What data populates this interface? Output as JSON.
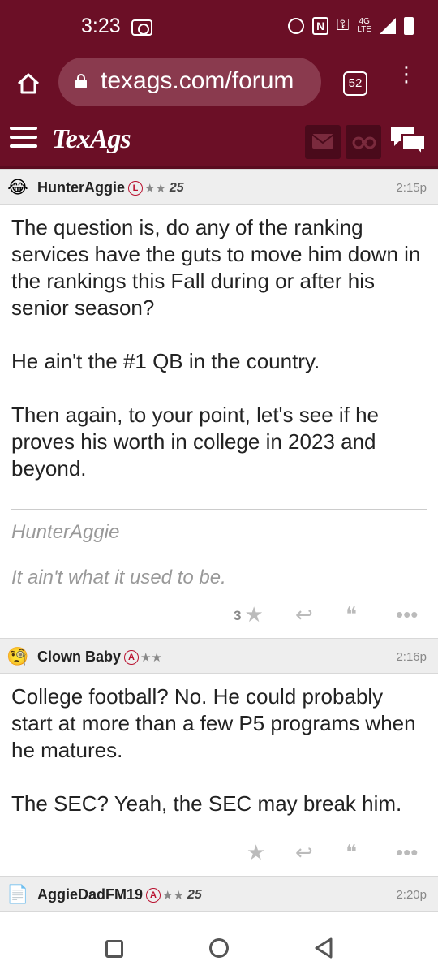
{
  "status_bar": {
    "time": "3:23",
    "network": "4G LTE"
  },
  "browser": {
    "url": "texags.com/forum",
    "tab_count": "52",
    "menu_glyph": "⋮"
  },
  "site": {
    "logo": "TexAgs"
  },
  "posts": [
    {
      "avatar_icon": "laughing-face-icon",
      "username": "HunterAggie",
      "badge": "L",
      "stars": "★★",
      "years": "25",
      "time": "2:15p",
      "paragraphs": [
        "The question is, do any of the ranking services have the guts to move him down in the rankings this Fall during or after his senior season?",
        "He ain't the #1 QB in the country.",
        "Then again, to your point, let's see if he proves his worth in college in 2023 and beyond."
      ],
      "signature": [
        "HunterAggie",
        "It ain't what it used to be."
      ],
      "star_count": "3"
    },
    {
      "avatar_icon": "monocle-face-icon",
      "username": "Clown Baby",
      "badge": "A",
      "stars": "★★",
      "years": "",
      "time": "2:16p",
      "paragraphs": [
        "College football? No. He could probably start at more than a few P5 programs when he matures.",
        "The SEC? Yeah, the SEC may break him."
      ],
      "star_count": ""
    },
    {
      "avatar_icon": "document-icon",
      "username": "AggieDadFM19",
      "badge": "A",
      "stars": "★★",
      "years": "25",
      "time": "2:20p"
    }
  ],
  "colors": {
    "maroon": "#6b0f26",
    "badge_red": "#b9112f",
    "muted": "#888888"
  }
}
